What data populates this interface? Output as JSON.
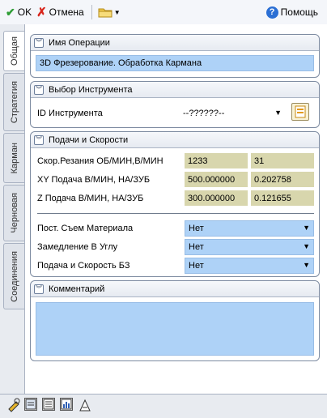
{
  "toolbar": {
    "ok_label": "OK",
    "cancel_label": "Отмена",
    "help_label": "Помощь"
  },
  "vtabs": [
    "Общая",
    "Стратегия",
    "Карман",
    "Черновая",
    "Соединения"
  ],
  "groups": {
    "operation": {
      "title": "Имя Операции",
      "name_value": "3D Фрезерование. Обработка Кармана"
    },
    "tool": {
      "title": "Выбор Инструмента",
      "id_label": "ID Инструмента",
      "id_value": "--??????--"
    },
    "feeds": {
      "title": "Подачи и Скорости",
      "rows": [
        {
          "label": "Скор.Резания ОБ/МИН,В/МИН",
          "v1": "1233",
          "v2": "31"
        },
        {
          "label": "XY Подача В/МИН, НА/ЗУБ",
          "v1": "500.000000",
          "v2": "0.202758"
        },
        {
          "label": "Z Подача В/МИН, НА/ЗУБ",
          "v1": "300.000000",
          "v2": "0.121655"
        }
      ],
      "options": [
        {
          "label": "Пост. Съем Материала",
          "value": "Нет"
        },
        {
          "label": "Замедление В Углу",
          "value": "Нет"
        },
        {
          "label": "Подача и Скорость БЗ",
          "value": "Нет"
        }
      ]
    },
    "comment": {
      "title": "Комментарий",
      "value": ""
    }
  },
  "bottom_tabs": [
    "tool-tab",
    "doc-tab",
    "list-tab",
    "chart-tab",
    "machine-tab"
  ]
}
